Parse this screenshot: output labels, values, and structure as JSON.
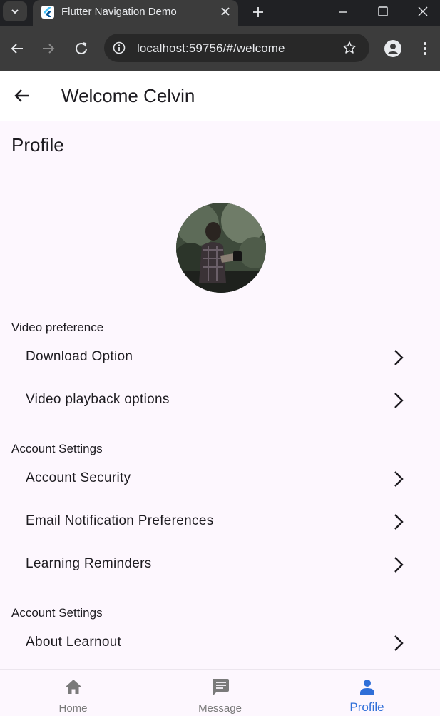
{
  "browser": {
    "tab_title": "Flutter Navigation Demo",
    "url": "localhost:59756/#/welcome"
  },
  "appbar": {
    "title": "Welcome Celvin"
  },
  "profile": {
    "heading": "Profile"
  },
  "groups": [
    {
      "label": "Video preference",
      "items": [
        {
          "label": "Download Option"
        },
        {
          "label": "Video playback options"
        }
      ]
    },
    {
      "label": "Account Settings",
      "items": [
        {
          "label": "Account Security"
        },
        {
          "label": "Email Notification Preferences"
        },
        {
          "label": "Learning Reminders"
        }
      ]
    },
    {
      "label": "Account Settings",
      "items": [
        {
          "label": "About Learnout"
        }
      ]
    }
  ],
  "bottom_nav": [
    {
      "label": "Home",
      "icon": "home-icon"
    },
    {
      "label": "Message",
      "icon": "message-icon"
    },
    {
      "label": "Profile",
      "icon": "person-icon",
      "active": true
    }
  ],
  "colors": {
    "background": "#fdf7fe",
    "accent": "#2f6fd8",
    "text": "#1d1b20"
  }
}
